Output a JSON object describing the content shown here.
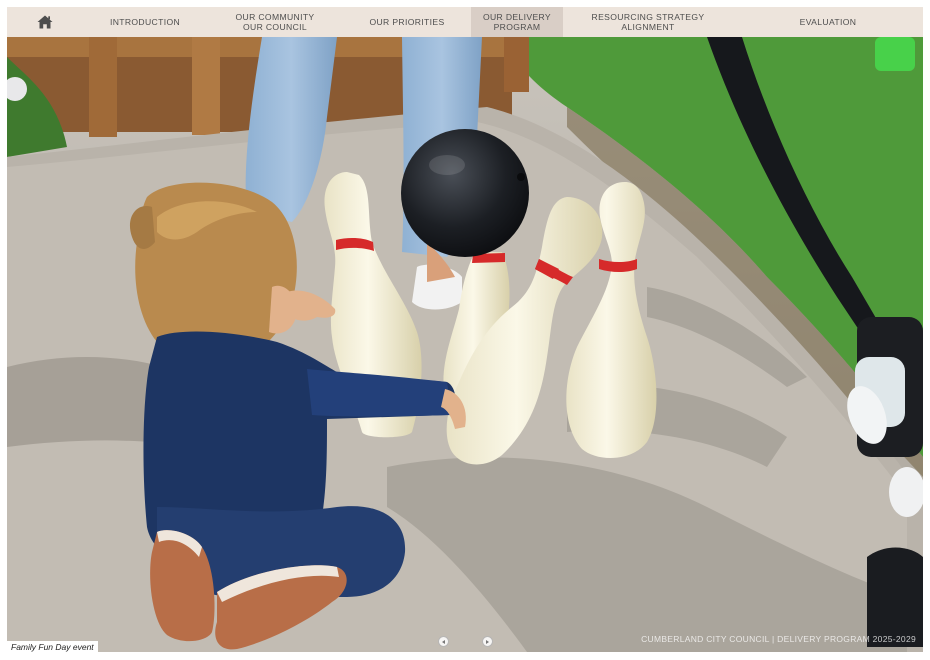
{
  "nav": {
    "home_icon": "home-icon",
    "items": [
      {
        "line1": "Introduction",
        "line2": ""
      },
      {
        "line1": "Our Community",
        "line2": "Our Council"
      },
      {
        "line1": "Our Priorities",
        "line2": ""
      },
      {
        "line1": "Our Delivery",
        "line2": "Program"
      },
      {
        "line1": "Resourcing Strategy",
        "line2": "Alignment"
      },
      {
        "line1": "Evaluation",
        "line2": ""
      }
    ],
    "active_index": 3
  },
  "hero": {
    "caption": "Family Fun Day event"
  },
  "footer": {
    "text": "CUMBERLAND CITY COUNCIL  |  DELIVERY PROGRAM 2025-2029"
  },
  "pager": {
    "prev_icon": "chevron-left-icon",
    "next_icon": "chevron-right-icon"
  },
  "colors": {
    "nav_bg": "#ede4dc",
    "nav_active_bg": "#d9cec6",
    "nav_text": "#4e4e4e",
    "pin_stripe": "#d62a2a",
    "ball": "#1c1f24",
    "grass": "#4f9a3a"
  }
}
